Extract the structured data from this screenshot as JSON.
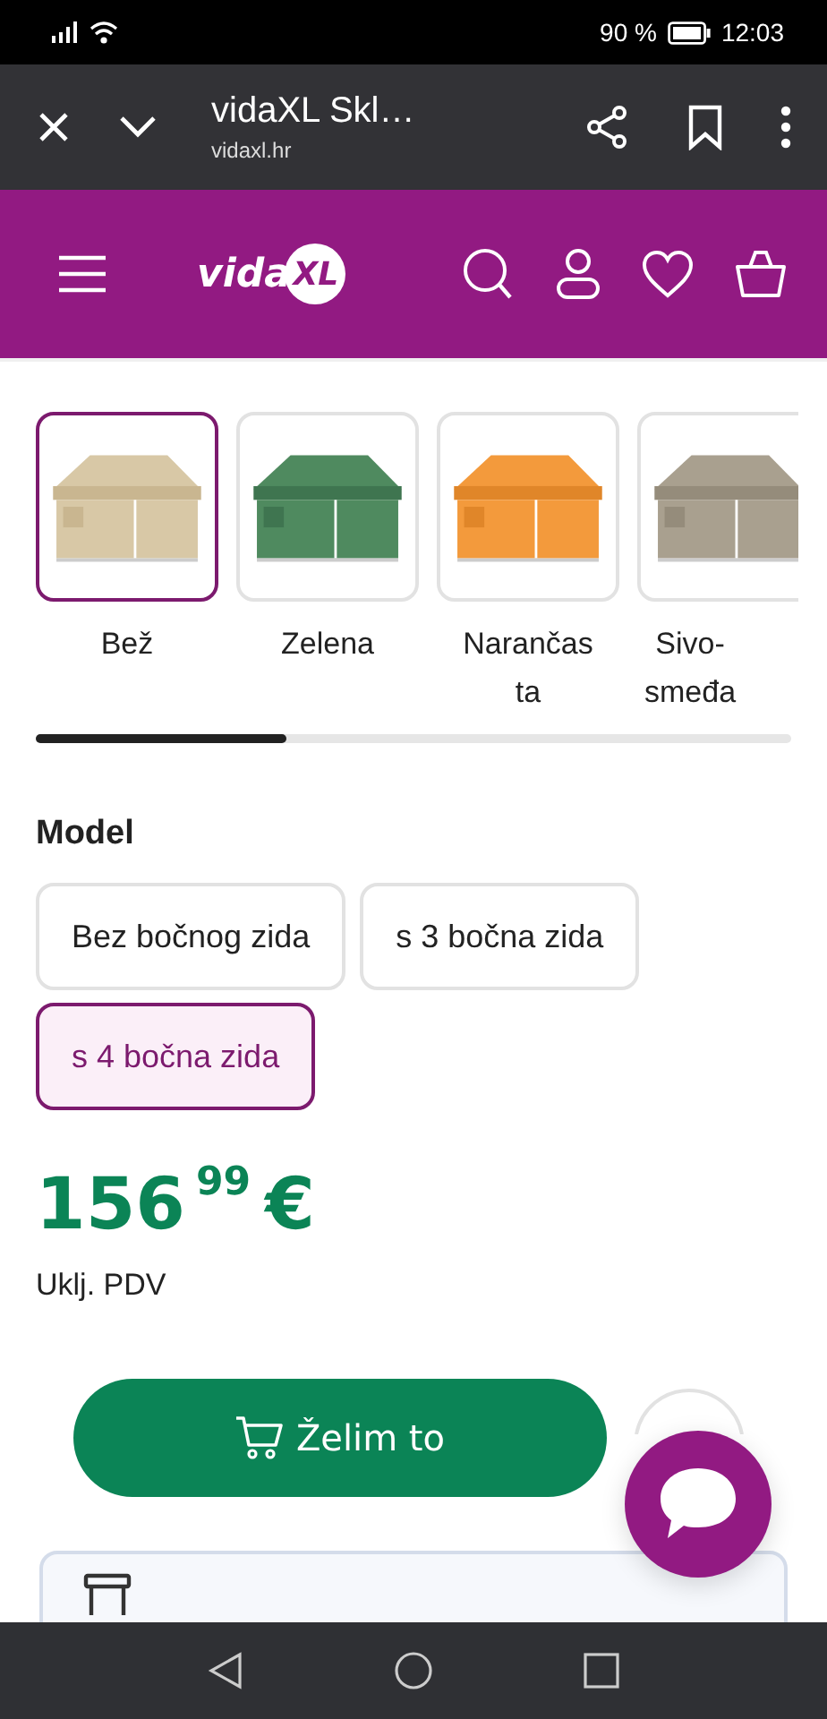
{
  "status_bar": {
    "battery_text": "90 %",
    "time": "12:03"
  },
  "browser_bar": {
    "title": "vidaXL Skl…",
    "url": "vidaxl.hr"
  },
  "site_header": {
    "logo": {
      "text": "vida",
      "badge": "XL"
    }
  },
  "swatches": [
    {
      "label": "Bež",
      "selected": true
    },
    {
      "label": "Zelena",
      "selected": false
    },
    {
      "label": "Narančas\nta",
      "selected": false
    },
    {
      "label": "Sivo-\nsmeđa",
      "selected": false
    }
  ],
  "model": {
    "title": "Model",
    "options": [
      {
        "label": "Bez bočnog zida",
        "selected": false
      },
      {
        "label": "s 3 bočna zida",
        "selected": false
      },
      {
        "label": "s 4 bočna zida",
        "selected": true
      }
    ]
  },
  "price": {
    "whole": "156",
    "cents": "99",
    "currency": "€",
    "note": "Uklj. PDV"
  },
  "cart_button": {
    "label": "Želim to"
  }
}
